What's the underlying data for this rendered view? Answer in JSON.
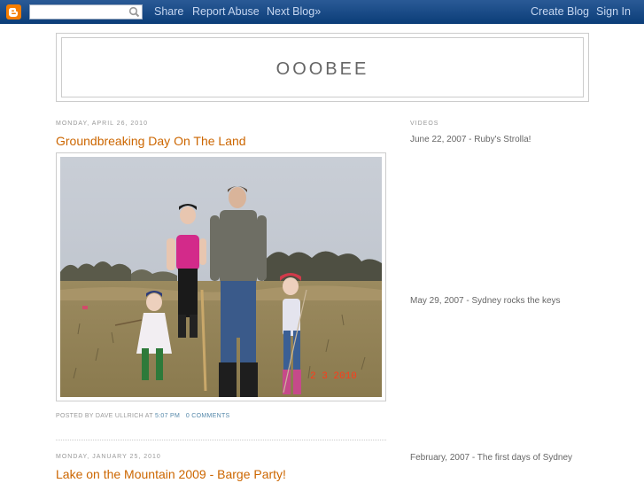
{
  "navbar": {
    "search_placeholder": "",
    "links": [
      "Share",
      "Report Abuse",
      "Next Blog»"
    ],
    "right_links": [
      "Create Blog",
      "Sign In"
    ]
  },
  "blog": {
    "title": "OOOBEE"
  },
  "posts": [
    {
      "date": "Monday, April 26, 2010",
      "title": "Groundbreaking Day On The Land",
      "photo_date_stamp": "2 3 2010",
      "footer_prefix": "Posted by Dave Ullrich at",
      "time": "5:07 PM",
      "comments": "0 comments"
    },
    {
      "date": "Monday, January 25, 2010",
      "title": "Lake on the Mountain 2009 - Barge Party!"
    }
  ],
  "sidebar": {
    "heading": "Videos",
    "videos": [
      "June 22, 2007 - Ruby's Strolla!",
      "May 29, 2007 - Sydney rocks the keys",
      "February, 2007 - The first days of Sydney"
    ]
  },
  "colors": {
    "navbar_bg": "#0b3d78",
    "post_title": "#cc6600",
    "blogger_logo": "#f57d00"
  }
}
